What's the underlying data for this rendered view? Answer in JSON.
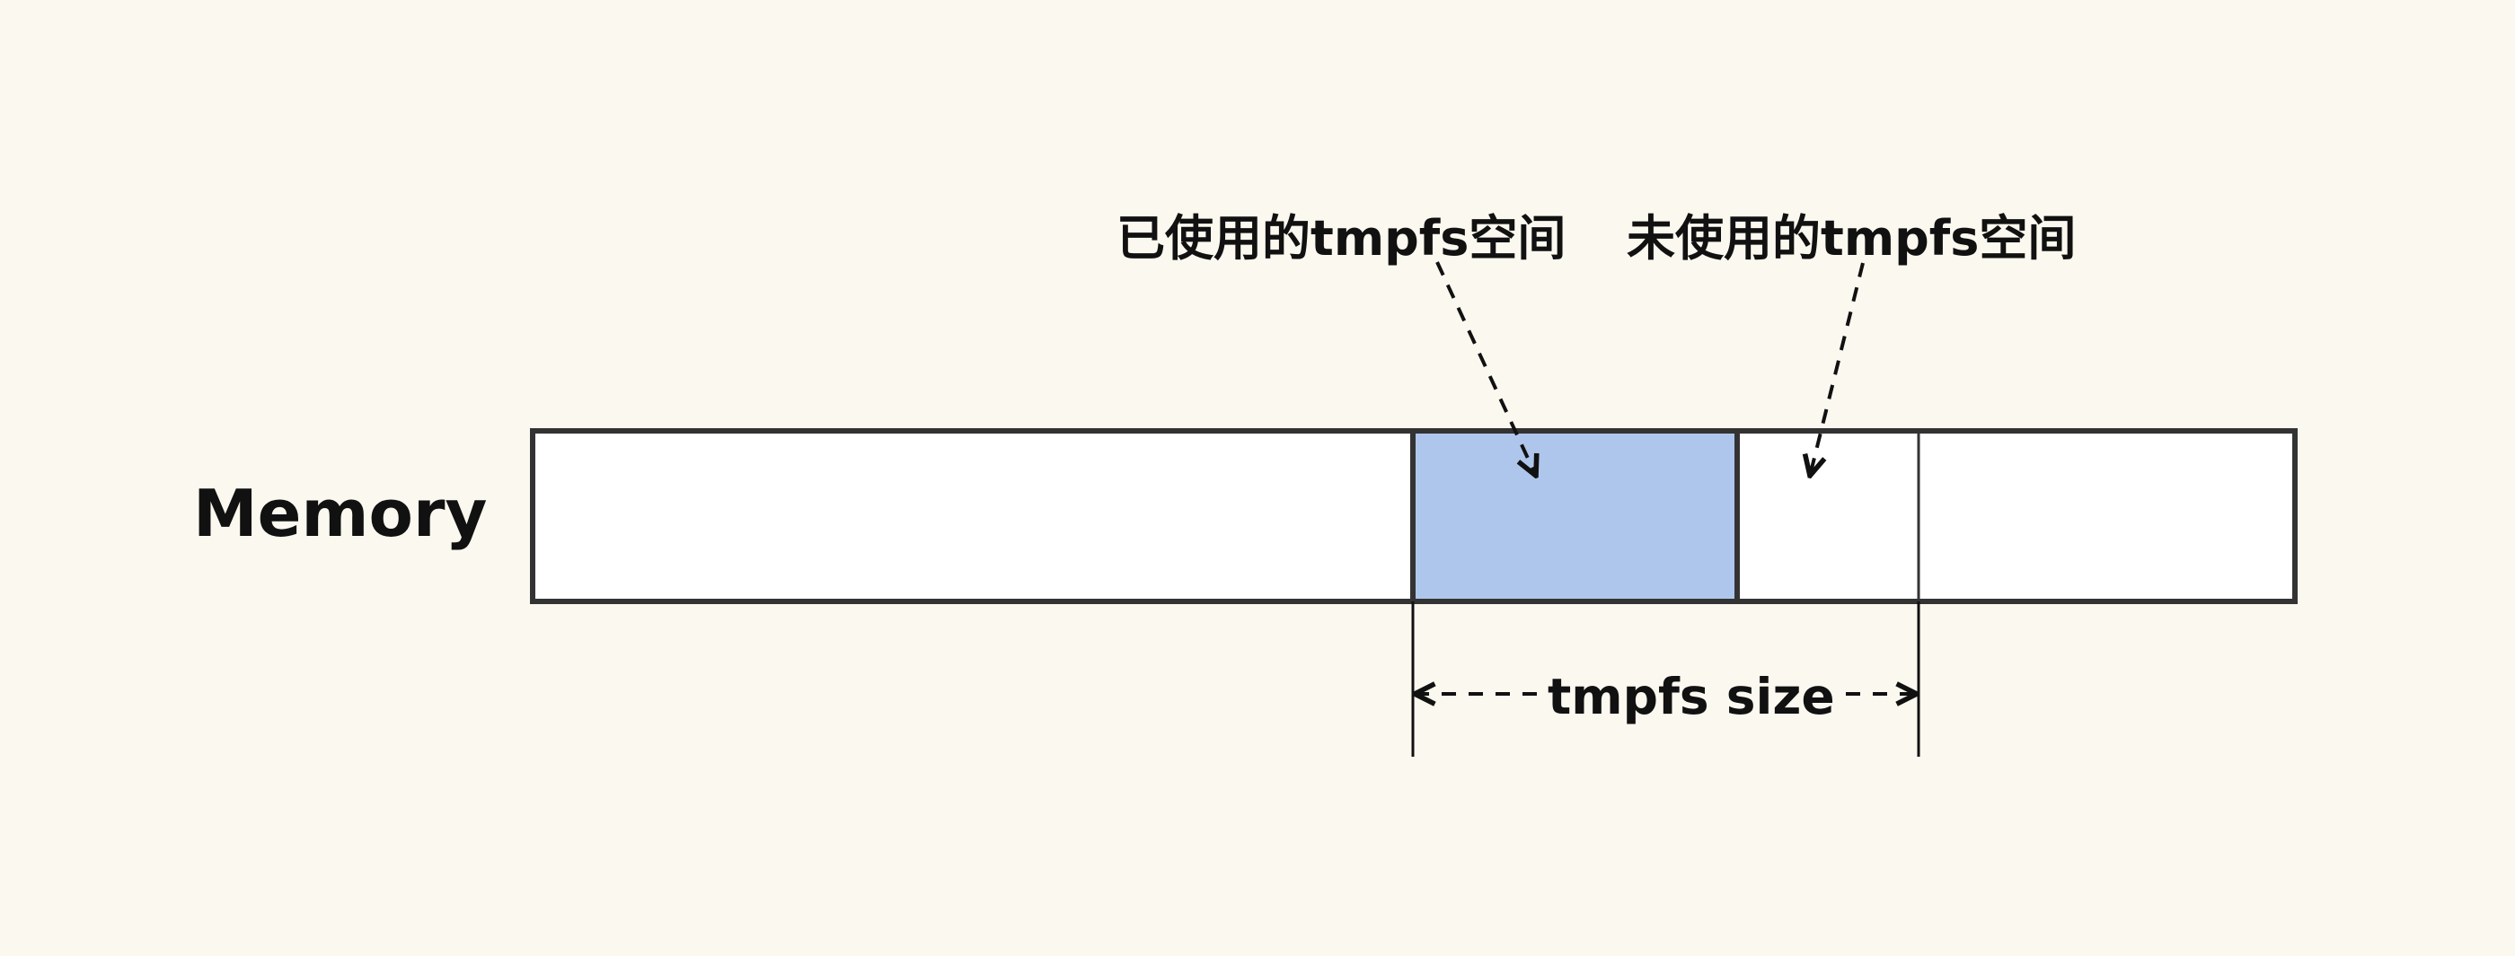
{
  "diagram": {
    "memory_label": "Memory",
    "used_space_label": "已使用的tmpfs空间",
    "unused_space_label": "未使用的tmpfs空间",
    "tmpfs_size_label": "tmpfs size"
  },
  "colors": {
    "background": "#fbf8ef",
    "used_space_fill": "#aec6ec",
    "border": "#333333",
    "text": "#111111"
  }
}
